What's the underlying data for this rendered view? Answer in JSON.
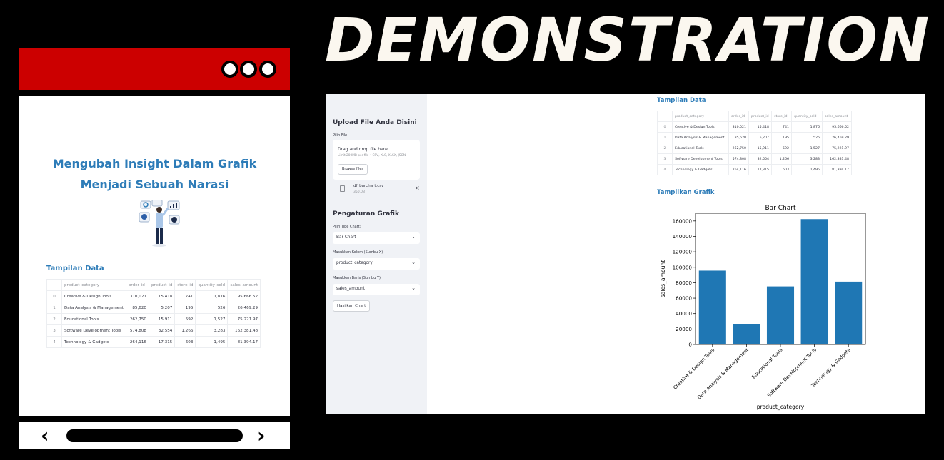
{
  "header": {
    "title": "DEMONSTRATION"
  },
  "mockup": {
    "hero_title": "Mengubah Insight Dalam Grafik Menjadi Sebuah Narasi",
    "section_title": "Tampilan Data",
    "nav": {
      "prev": "‹",
      "next": "›"
    }
  },
  "table": {
    "columns": [
      "",
      "product_category",
      "order_id",
      "product_id",
      "store_id",
      "quantity_sold",
      "sales_amount"
    ],
    "rows": [
      [
        "0",
        "Creative & Design Tools",
        "310,021",
        "15,418",
        "741",
        "1,876",
        "95,666.52"
      ],
      [
        "1",
        "Data Analysis & Management",
        "85,620",
        "5,207",
        "195",
        "526",
        "26,469.29"
      ],
      [
        "2",
        "Educational Tools",
        "262,750",
        "15,911",
        "592",
        "1,527",
        "75,221.97"
      ],
      [
        "3",
        "Software Development Tools",
        "574,808",
        "32,554",
        "1,266",
        "3,283",
        "162,381.48"
      ],
      [
        "4",
        "Technology & Gadgets",
        "264,116",
        "17,315",
        "603",
        "1,495",
        "81,394.17"
      ]
    ]
  },
  "sidebar": {
    "upload_title": "Upload File Anda Disini",
    "file_label": "Pilih File",
    "drop_text": "Drag and drop file here",
    "limit_text": "Limit 200MB per file • CSV, XLS, XLSX, JSON",
    "browse_label": "Browse files",
    "file_name": "df_barchart.csv",
    "file_size": "350.0B",
    "close_glyph": "×",
    "settings_title": "Pengaturan Grafik",
    "chart_type_label": "Pilih Tipe Chart:",
    "chart_type_value": "Bar Chart",
    "x_label": "Masukkan Kolom (Sumbu X)",
    "x_value": "product_category",
    "y_label": "Masukkan Baris (Sumbu Y)",
    "y_value": "sales_amount",
    "chevron_glyph": "⌄",
    "generate_label": "Hasilkan Chart"
  },
  "main": {
    "data_title": "Tampilan Data",
    "chart_section_title": "Tampilkan Grafik"
  },
  "colors": {
    "accent": "#2d7cb8",
    "bar": "#1f77b4",
    "mock_topbar": "#cc0000"
  },
  "chart_data": {
    "type": "bar",
    "title": "Bar Chart",
    "xlabel": "product_category",
    "ylabel": "sales_amount",
    "categories": [
      "Creative & Design Tools",
      "Data Analysis & Management",
      "Educational Tools",
      "Software Development Tools",
      "Technology & Gadgets"
    ],
    "values": [
      95666.52,
      26469.29,
      75221.97,
      162381.48,
      81394.17
    ],
    "ylim": [
      0,
      170000
    ],
    "yticks": [
      0,
      20000,
      40000,
      60000,
      80000,
      100000,
      120000,
      140000,
      160000
    ],
    "grid": false
  }
}
